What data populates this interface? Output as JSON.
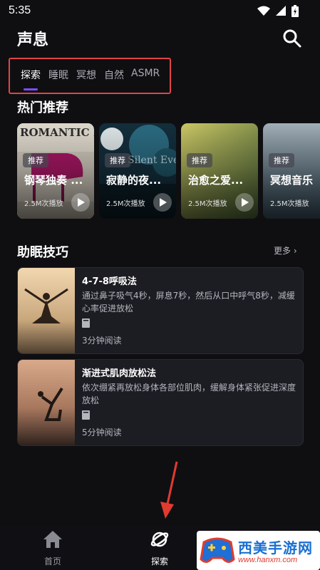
{
  "status_bar": {
    "time": "5:35"
  },
  "header": {
    "title": "声息"
  },
  "tabs": [
    {
      "label": "探索",
      "active": true
    },
    {
      "label": "睡眠",
      "active": false
    },
    {
      "label": "冥想",
      "active": false
    },
    {
      "label": "自然",
      "active": false
    },
    {
      "label": "ASMR",
      "active": false
    }
  ],
  "recommend": {
    "title": "热门推荐",
    "items": [
      {
        "tag": "推荐",
        "title": "钢琴独奏 ...",
        "plays": "2.5M次播放",
        "cover_text": "ROMANTIC PIANO"
      },
      {
        "tag": "推荐",
        "title": "寂静的夜...",
        "plays": "2.5M次播放",
        "cover_text": "Silent Evening"
      },
      {
        "tag": "推荐",
        "title": "治愈之爱...",
        "plays": "2.5M次播放"
      },
      {
        "tag": "推荐",
        "title": "冥想音乐",
        "plays": "2.5M次播放"
      }
    ]
  },
  "tips": {
    "title": "助眠技巧",
    "more": "更多",
    "items": [
      {
        "title": "4-7-8呼吸法",
        "desc": "通过鼻子吸气4秒，屏息7秒，然后从口中呼气8秒，减缓心率促进放松",
        "read": "3分钟阅读"
      },
      {
        "title": "渐进式肌肉放松法",
        "desc": "依次绷紧再放松身体各部位肌肉，缓解身体紧张促进深度放松",
        "read": "5分钟阅读"
      }
    ]
  },
  "bottom_nav": [
    {
      "label": "首页",
      "icon": "home-icon",
      "active": false
    },
    {
      "label": "探索",
      "icon": "planet-icon",
      "active": true
    }
  ],
  "watermark": {
    "text": "西美手游网",
    "url": "www.hanxm.com"
  },
  "colors": {
    "accent": "#7c4dff",
    "highlight_box": "#e04545",
    "background": "#0f0f12",
    "card": "#1c1c23"
  }
}
